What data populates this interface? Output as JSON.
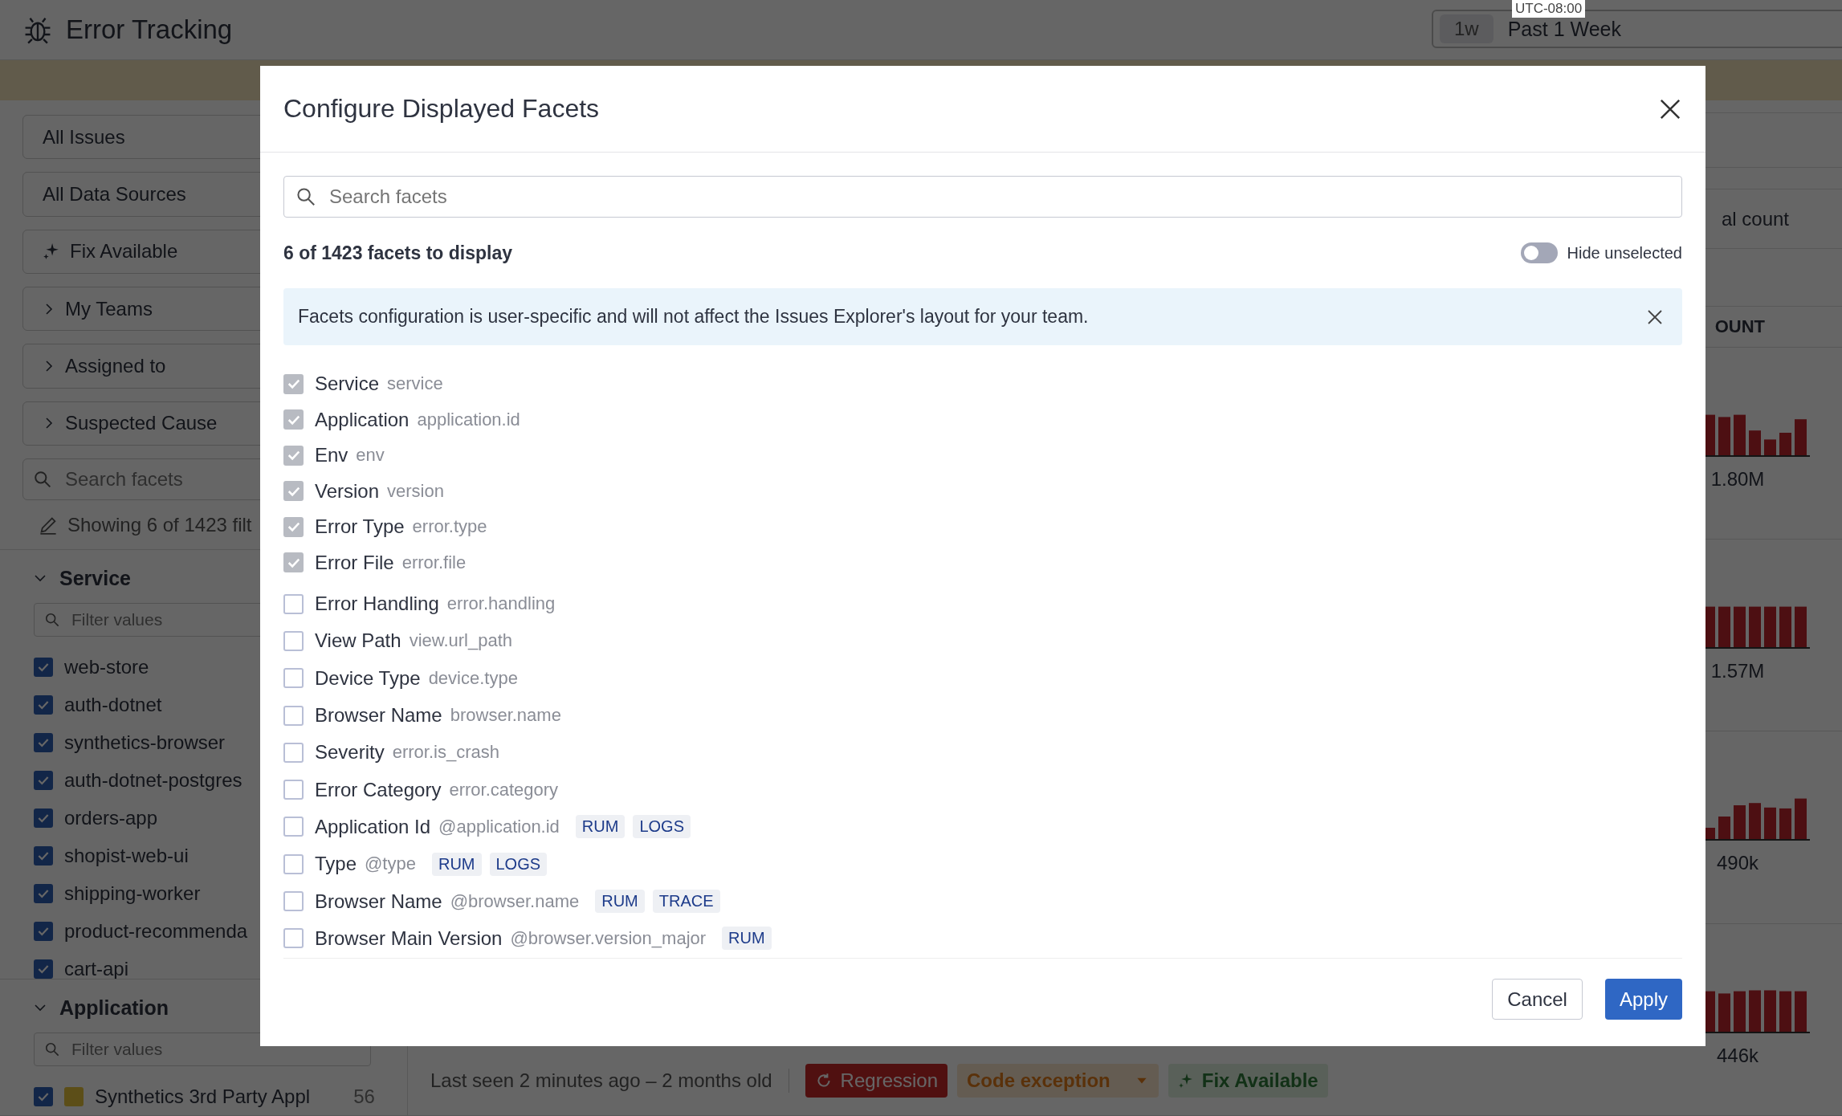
{
  "app": {
    "title": "Error Tracking"
  },
  "time_picker": {
    "timezone": "UTC-08:00",
    "shortcut": "1w",
    "label": "Past 1 Week"
  },
  "sidebar": {
    "filters": [
      {
        "label": "All Issues",
        "kind": "plain"
      },
      {
        "label": "All Data Sources",
        "kind": "plain"
      },
      {
        "label": "Fix Available",
        "kind": "sparkle"
      },
      {
        "label": "My Teams",
        "kind": "expandable"
      },
      {
        "label": "Assigned to",
        "kind": "expandable"
      },
      {
        "label": "Suspected Cause",
        "kind": "expandable"
      }
    ],
    "search": {
      "placeholder": "Search facets"
    },
    "showing": "Showing 6 of 1423 filt",
    "sections": [
      {
        "title": "Service",
        "expanded": true,
        "filter_placeholder": "Filter values",
        "values": [
          {
            "label": "web-store",
            "checked": true
          },
          {
            "label": "auth-dotnet",
            "checked": true
          },
          {
            "label": "synthetics-browser",
            "checked": true
          },
          {
            "label": "auth-dotnet-postgres",
            "checked": true
          },
          {
            "label": "orders-app",
            "checked": true
          },
          {
            "label": "shopist-web-ui",
            "checked": true
          },
          {
            "label": "shipping-worker",
            "checked": true
          },
          {
            "label": "product-recommenda",
            "checked": true
          },
          {
            "label": "cart-api",
            "checked": true
          }
        ]
      },
      {
        "title": "Application",
        "expanded": true,
        "filter_placeholder": "Filter values",
        "values": [
          {
            "label": "Synthetics 3rd Party Appl",
            "count": "56",
            "checked": true
          }
        ]
      }
    ]
  },
  "main": {
    "column_header": "al count",
    "count_heading": "OUNT",
    "issues": [
      {
        "count": "1.80M"
      },
      {
        "count": "1.57M"
      },
      {
        "count": "490k"
      },
      {
        "count": "446k",
        "last_seen": "Last seen 2 minutes ago – 2 months old",
        "tags": [
          {
            "label": "Regression",
            "kind": "regression"
          },
          {
            "label": "Code exception",
            "kind": "dropdown"
          },
          {
            "label": "Fix Available",
            "kind": "fix"
          }
        ]
      }
    ]
  },
  "modal": {
    "title": "Configure Displayed Facets",
    "search_placeholder": "Search facets",
    "summary": "6 of 1423 facets to display",
    "hide_unselected": {
      "label": "Hide unselected",
      "on": false
    },
    "notice": "Facets configuration is user-specific and will not affect the Issues Explorer's layout for your team.",
    "facets": [
      {
        "name": "Service",
        "path": "service",
        "checked": true
      },
      {
        "name": "Application",
        "path": "application.id",
        "checked": true
      },
      {
        "name": "Env",
        "path": "env",
        "checked": true
      },
      {
        "name": "Version",
        "path": "version",
        "checked": true
      },
      {
        "name": "Error Type",
        "path": "error.type",
        "checked": true
      },
      {
        "name": "Error File",
        "path": "error.file",
        "checked": true
      },
      {
        "name": "Error Handling",
        "path": "error.handling",
        "checked": false
      },
      {
        "name": "View Path",
        "path": "view.url_path",
        "checked": false
      },
      {
        "name": "Device Type",
        "path": "device.type",
        "checked": false
      },
      {
        "name": "Browser Name",
        "path": "browser.name",
        "checked": false
      },
      {
        "name": "Severity",
        "path": "error.is_crash",
        "checked": false
      },
      {
        "name": "Error Category",
        "path": "error.category",
        "checked": false
      },
      {
        "name": "Application Id",
        "path": "@application.id",
        "checked": false,
        "sources": [
          "RUM",
          "LOGS"
        ]
      },
      {
        "name": "Type",
        "path": "@type",
        "checked": false,
        "sources": [
          "RUM",
          "LOGS"
        ]
      },
      {
        "name": "Browser Name",
        "path": "@browser.name",
        "checked": false,
        "sources": [
          "RUM",
          "TRACE"
        ]
      },
      {
        "name": "Browser Main Version",
        "path": "@browser.version_major",
        "checked": false,
        "sources": [
          "RUM"
        ]
      }
    ],
    "cancel": "Cancel",
    "apply": "Apply"
  }
}
